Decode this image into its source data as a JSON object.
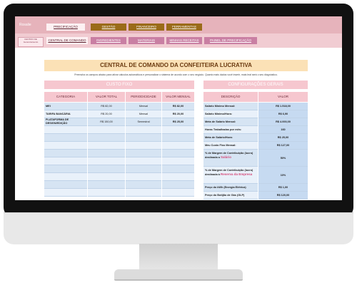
{
  "header": {
    "brand": "Rosalie",
    "logo_text": "CENTRO DE Gerenciamento",
    "tabs_top": [
      "PRECIFICAÇÃO",
      "GESTÃO",
      "FINANCEIRO",
      "FERRAMENTAS"
    ],
    "tabs_bottom": [
      "CENTRAL DE COMANDO",
      "INGREDIENTES",
      "MATERIAIS",
      "MINHAS RECEITAS",
      "PAINEL DE PRECIFICAÇÃO"
    ]
  },
  "page": {
    "title": "CENTRAL DE COMANDO DA CONFEITEIRA LUCRATIVA",
    "subtitle": "Preencha os campos abaixo para ativar cálculos automáticos e personalizar o sistema de acordo com o seu negócio. Quanto mais dados você inserir, mais leal será o seu diagnóstico."
  },
  "fixed_cost": {
    "section_title": "CUSTO FIXO",
    "columns": [
      "CATEGORIA",
      "VALOR TOTAL",
      "PERIODICIDADE",
      "VALOR MENSAL"
    ],
    "rows": [
      {
        "category": "MEI",
        "total": "R$ 82,00",
        "period": "Mensal",
        "monthly": "R$ 82,00"
      },
      {
        "category": "TARIFA BANCÁRIA",
        "total": "R$ 20,00",
        "period": "Mensal",
        "monthly": "R$ 20,00"
      },
      {
        "category": "PLATAFORMA DE DESIGN/EDIÇÃO",
        "total": "R$ 150,00",
        "period": "Semestral",
        "monthly": "R$ 25,00"
      }
    ]
  },
  "settings": {
    "section_title": "CONFIGURAÇÕES GERAIS",
    "columns": [
      "DESCRIÇÃO",
      "VALOR"
    ],
    "rows": [
      {
        "label": "Salário Mínimo Mensal:",
        "value": "R$ 1.518,00"
      },
      {
        "label": "Salário Mínimo/Hora:",
        "value": "R$ 6,90"
      },
      {
        "label": "Meta de Salário Mensal:",
        "value": "R$ 4.000,00"
      },
      {
        "label": "Horas Trabalhadas por mês:",
        "value": "160"
      },
      {
        "label": "Meta de Salário/Hora:",
        "value": "R$ 25,00"
      },
      {
        "label": "Meu Custo Fixo Mensal:",
        "value": "R$ 127,00"
      },
      {
        "label": "% de Margem de Contribuição (lucro) destinada a",
        "highlight": "Salário",
        "value": "50%"
      },
      {
        "label": "% de Margem de Contribuição (lucro) destinada à",
        "highlight": "Reserva da Empresa",
        "value": "10%"
      },
      {
        "label": "Preço do kWh (Energia Elétrica)",
        "value": "R$ 1,00"
      },
      {
        "label": "Preço do Botijão de Gás (GLP)",
        "value": "R$ 120,00"
      }
    ]
  }
}
